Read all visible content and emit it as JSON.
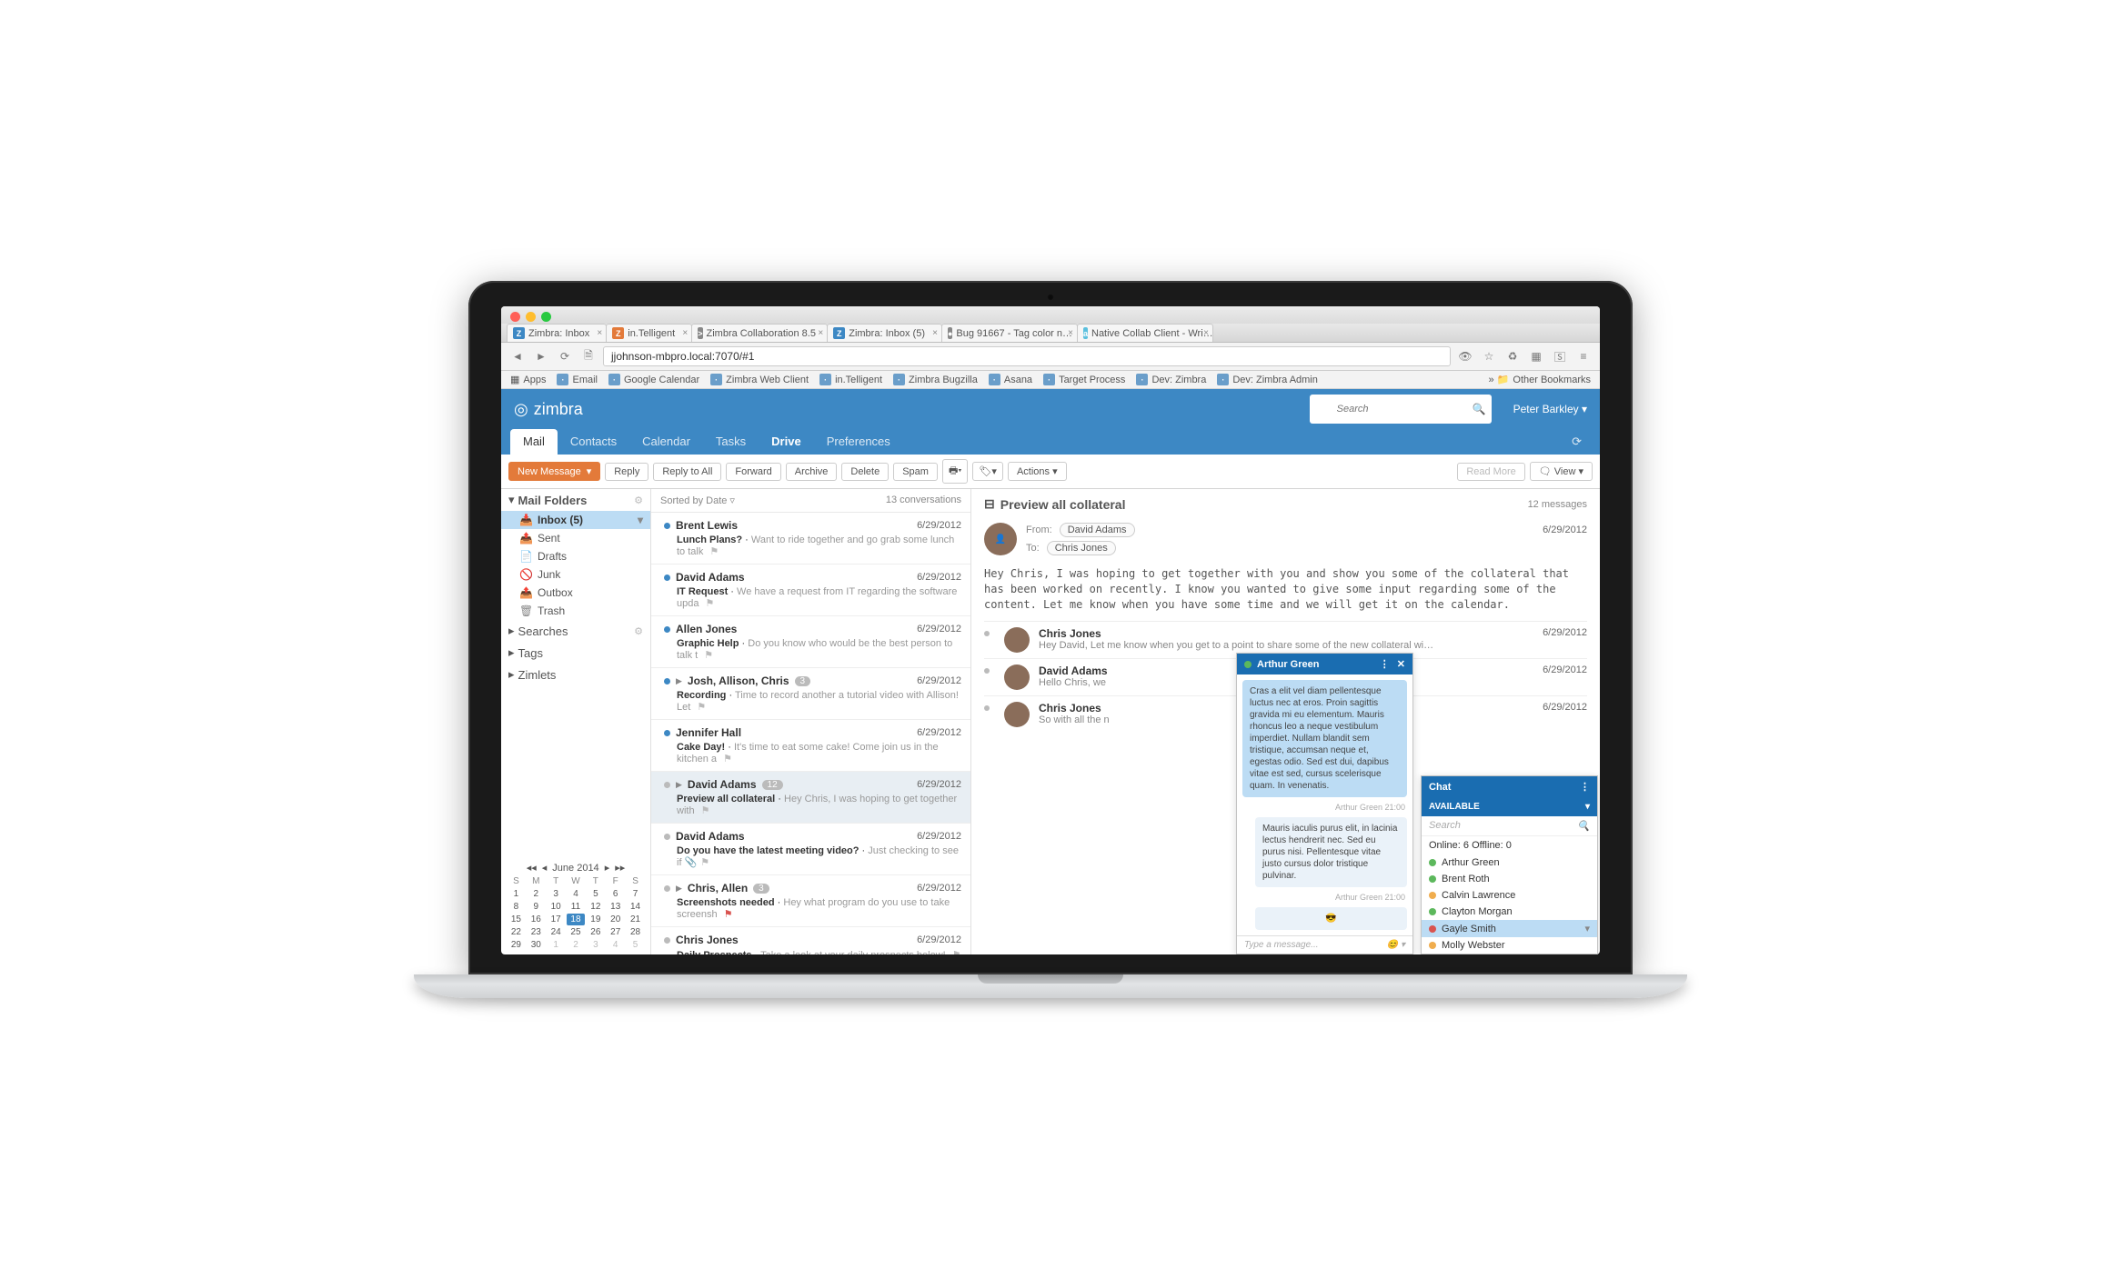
{
  "browser": {
    "tabs": [
      {
        "label": "Zimbra: Inbox",
        "icon_bg": "#3d88c4",
        "icon_txt": "Z"
      },
      {
        "label": "in.Telligent",
        "icon_bg": "#e37a3a",
        "icon_txt": "Z"
      },
      {
        "label": "Zimbra Collaboration 8.5",
        "icon_bg": "#888",
        "icon_txt": ">"
      },
      {
        "label": "Zimbra: Inbox (5)",
        "icon_bg": "#3d88c4",
        "icon_txt": "Z"
      },
      {
        "label": "Bug 91667 - Tag color n…",
        "icon_bg": "#888",
        "icon_txt": "●"
      },
      {
        "label": "Native Collab Client - Wri…",
        "icon_bg": "#5bc0de",
        "icon_txt": "a"
      }
    ],
    "url": "jjohnson-mbpro.local:7070/#1",
    "bookmarks": [
      "Apps",
      "Email",
      "Google Calendar",
      "Zimbra Web Client",
      "in.Telligent",
      "Zimbra Bugzilla",
      "Asana",
      "Target Process",
      "Dev: Zimbra",
      "Dev: Zimbra Admin"
    ],
    "other_bookmarks": "Other Bookmarks"
  },
  "zimbra": {
    "brand": "zimbra",
    "search_placeholder": "Search",
    "user": "Peter Barkley",
    "tabs": {
      "mail": "Mail",
      "contacts": "Contacts",
      "calendar": "Calendar",
      "tasks": "Tasks",
      "drive": "Drive",
      "prefs": "Preferences"
    },
    "toolbar": {
      "new": "New Message",
      "reply": "Reply",
      "replyall": "Reply to All",
      "forward": "Forward",
      "archive": "Archive",
      "delete": "Delete",
      "spam": "Spam",
      "actions": "Actions",
      "readmore": "Read More",
      "view": "View"
    },
    "sidebar": {
      "mail_folders": "Mail Folders",
      "inbox": "Inbox (5)",
      "sent": "Sent",
      "drafts": "Drafts",
      "junk": "Junk",
      "outbox": "Outbox",
      "trash": "Trash",
      "searches": "Searches",
      "tags": "Tags",
      "zimlets": "Zimlets"
    },
    "calendar": {
      "month": "June 2014",
      "dow": [
        "S",
        "M",
        "T",
        "W",
        "T",
        "F",
        "S"
      ],
      "days": [
        1,
        2,
        3,
        4,
        5,
        6,
        7,
        8,
        9,
        10,
        11,
        12,
        13,
        14,
        15,
        16,
        17,
        18,
        19,
        20,
        21,
        22,
        23,
        24,
        25,
        26,
        27,
        28,
        29,
        30,
        1,
        2,
        3,
        4,
        5
      ],
      "selected": 18,
      "trail_start": 30
    },
    "list_header": {
      "sort": "Sorted by Date",
      "count": "13 conversations"
    },
    "messages": [
      {
        "from": "Brent Lewis",
        "date": "6/29/2012",
        "subj": "Lunch Plans?",
        "prev": "Want to ride together and go grab some lunch to talk",
        "unread": true
      },
      {
        "from": "David Adams",
        "date": "6/29/2012",
        "subj": "IT Request",
        "prev": "We have a request from IT regarding the software upda",
        "unread": true
      },
      {
        "from": "Allen Jones",
        "date": "6/29/2012",
        "subj": "Graphic Help",
        "prev": "Do you know who would be the best person to talk t",
        "unread": true
      },
      {
        "from": "Josh, Allison, Chris",
        "date": "6/29/2012",
        "subj": "Recording",
        "prev": "Time to record another a tutorial video with Allison! Let",
        "unread": true,
        "exp": true,
        "badge": "3"
      },
      {
        "from": "Jennifer Hall",
        "date": "6/29/2012",
        "subj": "Cake Day!",
        "prev": "It's time to eat some cake! Come join us in the kitchen a",
        "unread": true
      },
      {
        "from": "David Adams",
        "date": "6/29/2012",
        "subj": "Preview all collateral",
        "prev": "Hey Chris, I was hoping to get together with",
        "unread": false,
        "exp": true,
        "badge": "12",
        "sel": true
      },
      {
        "from": "David Adams",
        "date": "6/29/2012",
        "subj": "Do you have the latest meeting video?",
        "prev": "Just checking to see if",
        "unread": false,
        "attach": true
      },
      {
        "from": "Chris, Allen",
        "date": "6/29/2012",
        "subj": "Screenshots needed",
        "prev": "Hey what program do you use to take screensh",
        "unread": false,
        "exp": true,
        "badge": "3",
        "redflag": true
      },
      {
        "from": "Chris Jones",
        "date": "6/29/2012",
        "subj": "Daily Prospects",
        "prev": "Take a look at your daily prospects below!",
        "unread": false
      }
    ],
    "reading": {
      "subject": "Preview all collateral",
      "count": "12 messages",
      "from_label": "From:",
      "to_label": "To:",
      "from": "David Adams",
      "to": "Chris Jones",
      "date": "6/29/2012",
      "body": "Hey Chris, I was hoping to get together with you and show you some of the collateral that has been worked on recently. I know you wanted to give some input regarding some of the content. Let me know when you have some time and we will get it on the calendar.",
      "replies": [
        {
          "name": "Chris Jones",
          "prev": "Hey David, Let me know when you get to a point to share some of the new collateral wi…",
          "date": "6/29/2012"
        },
        {
          "name": "David Adams",
          "prev": "Hello Chris, we",
          "date": "6/29/2012"
        },
        {
          "name": "Chris Jones",
          "prev": "So with all the n",
          "date": "6/29/2012"
        }
      ]
    },
    "chat": {
      "title": "Chat",
      "available": "AVAILABLE",
      "search": "Search",
      "counts": "Online: 6 Offline: 0",
      "roster": [
        {
          "name": "Arthur Green",
          "p": "g"
        },
        {
          "name": "Brent Roth",
          "p": "g"
        },
        {
          "name": "Calvin Lawrence",
          "p": "y"
        },
        {
          "name": "Clayton Morgan",
          "p": "g"
        },
        {
          "name": "Gayle Smith",
          "p": "r",
          "sel": true
        },
        {
          "name": "Molly Webster",
          "p": "y"
        }
      ],
      "conv": {
        "name": "Arthur Green",
        "msg1": "Cras a elit vel diam pellentesque luctus nec at eros. Proin sagittis gravida mi eu elementum. Mauris rhoncus leo a neque vestibulum imperdiet. Nullam blandit sem tristique, accumsan neque et, egestas odio. Sed est dui, dapibus vitae est sed, cursus scelerisque quam. In venenatis.",
        "meta1": "Arthur Green   21:00",
        "msg2": "Mauris iaculis purus elit, in lacinia lectus hendrerit nec. Sed eu purus nisi. Pellentesque vitae justo cursus dolor tristique pulvinar.",
        "meta2": "Arthur Green   21:00",
        "input": "Type a message..."
      }
    }
  }
}
